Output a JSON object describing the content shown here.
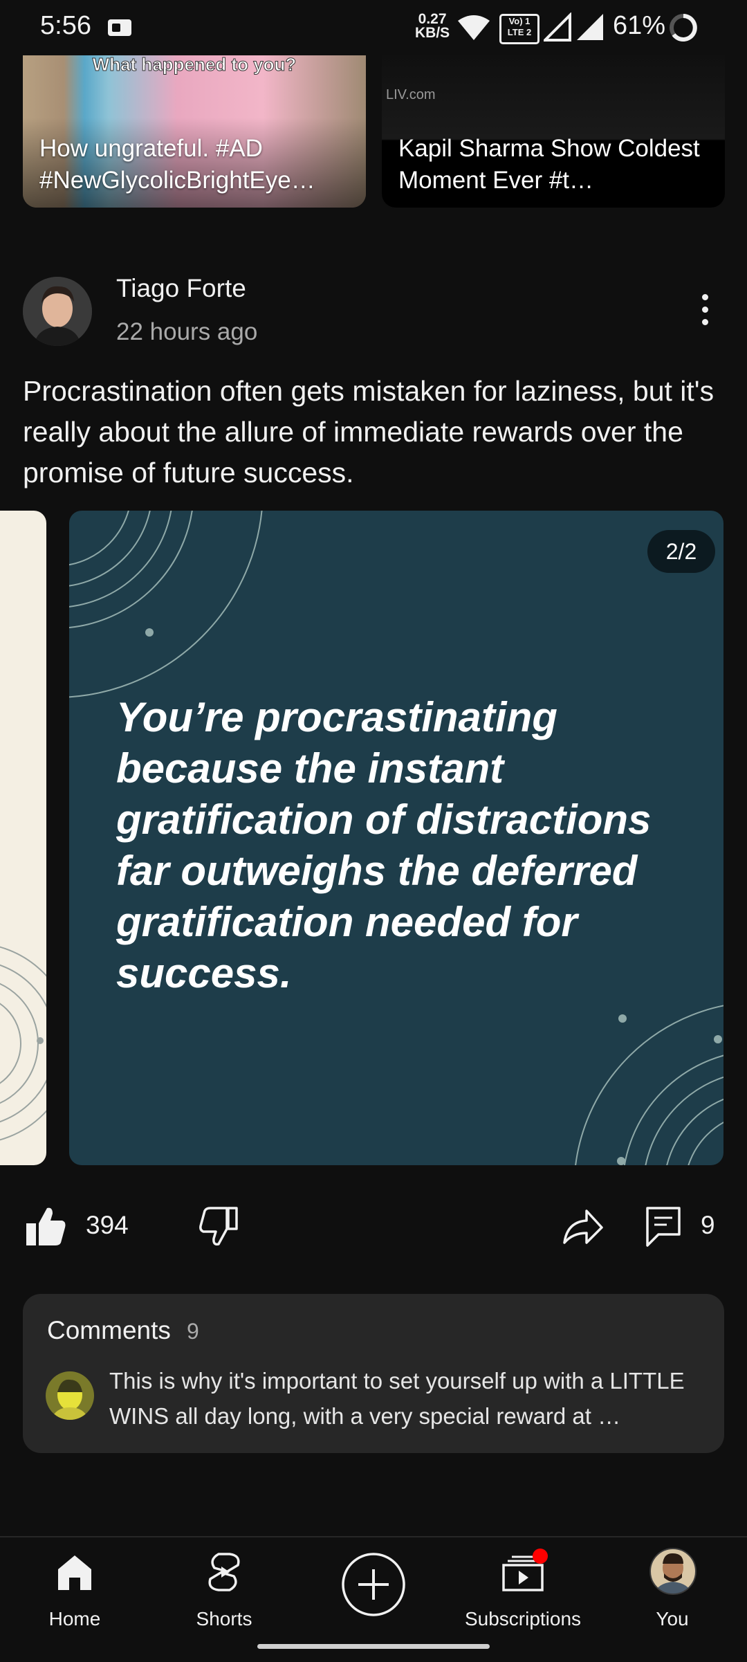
{
  "status_bar": {
    "time": "5:56",
    "net_speed": "0.27",
    "net_unit": "KB/S",
    "network_badge": "Vo) 1 LTE 2",
    "battery": "61%"
  },
  "shorts": [
    {
      "overlay_text": "What happened to you?",
      "title": "How ungrateful. #AD #NewGlycolicBrightEye…"
    },
    {
      "watermark": "LIV.com",
      "title": "Kapil Sharma Show Coldest Moment Ever #t…"
    }
  ],
  "post": {
    "author": "Tiago Forte",
    "time_ago": "22 hours ago",
    "text": "Procrastination often gets mistaken for laziness, but it's really about the allure of immediate rewards over the promise of future success.",
    "slide_counter": "2/2",
    "slide_quote": "You’re procrastinating because the instant gratification of distractions far outweighs the deferred gratification needed for success.",
    "likes": "394",
    "comments_count": "9"
  },
  "comments": {
    "title": "Comments",
    "count": "9",
    "top_comment": "This is why it's important to set yourself up with a LITTLE WINS all day long, with a very special reward at …"
  },
  "bottom_nav": {
    "home": "Home",
    "shorts": "Shorts",
    "subscriptions": "Subscriptions",
    "you": "You"
  },
  "icons": {
    "like": "thumb-up-icon",
    "dislike": "thumb-down-icon",
    "share": "share-icon",
    "comment": "comment-icon",
    "more": "more-vertical-icon",
    "create": "add-circle-icon"
  },
  "colors": {
    "background": "#0f0f0f",
    "slide_bg": "#1e3d4a",
    "card_bg": "#272727",
    "notification_dot": "#ff0000"
  }
}
